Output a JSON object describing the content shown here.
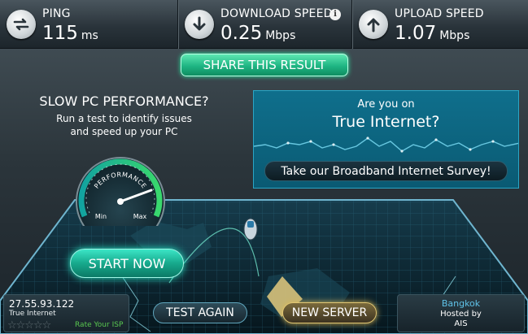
{
  "stats": {
    "ping": {
      "label": "PING",
      "value": "115",
      "unit": "ms",
      "icon": "ping-arrows-icon"
    },
    "download": {
      "label": "DOWNLOAD SPEED",
      "value": "0.25",
      "unit": "Mbps",
      "icon": "download-arrow-icon"
    },
    "upload": {
      "label": "UPLOAD SPEED",
      "value": "1.07",
      "unit": "Mbps",
      "icon": "upload-arrow-icon"
    }
  },
  "share": {
    "label": "SHARE THIS RESULT"
  },
  "promo": {
    "title": "SLOW PC PERFORMANCE?",
    "desc_line1": "Run a test to identify issues",
    "desc_line2": "and speed up your PC",
    "gauge_label": "PERFORMANCE",
    "gauge_min": "Min",
    "gauge_max": "Max",
    "start_label": "START NOW"
  },
  "survey": {
    "question": "Are you on",
    "isp": "True Internet?",
    "button": "Take our Broadband Internet Survey!"
  },
  "client": {
    "ip": "27.55.93.122",
    "isp": "True Internet",
    "stars": "☆☆☆☆☆",
    "rate_label": "Rate Your ISP"
  },
  "actions": {
    "test_again": "TEST AGAIN",
    "new_server": "NEW SERVER"
  },
  "server": {
    "city": "Bangkok",
    "hosted_label": "Hosted by",
    "host": "AIS"
  },
  "colors": {
    "accent_green": "#1fb583",
    "accent_teal": "#17a98c",
    "survey_blue": "#0f6f8c",
    "gold": "#e2c773"
  }
}
